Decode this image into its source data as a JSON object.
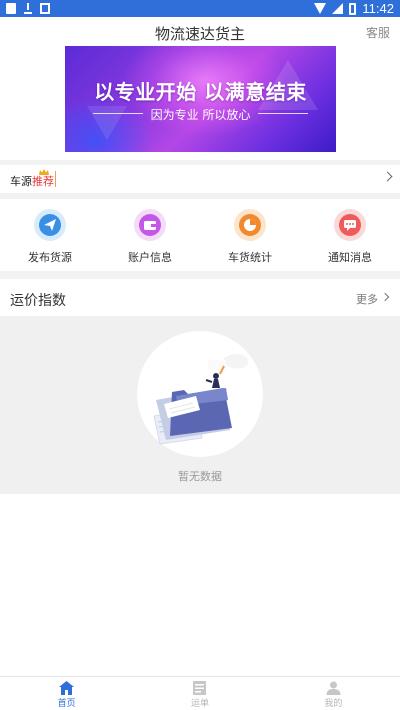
{
  "status_bar": {
    "time": "11:42"
  },
  "header": {
    "title": "物流速达货主",
    "service_label": "客服"
  },
  "banner": {
    "headline": "以专业开始 以满意结束",
    "subline": "因为专业 所以放心"
  },
  "source_row": {
    "label_prefix": "车源",
    "label_highlight": "推荐"
  },
  "features": [
    {
      "label": "发布货源",
      "icon": "paper-plane-icon",
      "color": "#3a8ee6",
      "bg": "#d6ecfb"
    },
    {
      "label": "账户信息",
      "icon": "wallet-icon",
      "color": "#c557e8",
      "bg": "#f3dcf8"
    },
    {
      "label": "车货统计",
      "icon": "pie-chart-icon",
      "color": "#f08a2c",
      "bg": "#fde4cc"
    },
    {
      "label": "通知消息",
      "icon": "message-icon",
      "color": "#ef5b5b",
      "bg": "#fbd9d9"
    }
  ],
  "freight_index": {
    "title": "运价指数",
    "more_label": "更多",
    "empty_text": "暂无数据"
  },
  "bottom_nav": [
    {
      "label": "首页",
      "icon": "home-icon",
      "active": true
    },
    {
      "label": "运单",
      "icon": "waybill-icon",
      "active": false
    },
    {
      "label": "我的",
      "icon": "user-icon",
      "active": false
    }
  ],
  "colors": {
    "primary": "#2f6fd9",
    "accent_red": "#e23b3b",
    "banner_purple": "#8a3ae0"
  }
}
